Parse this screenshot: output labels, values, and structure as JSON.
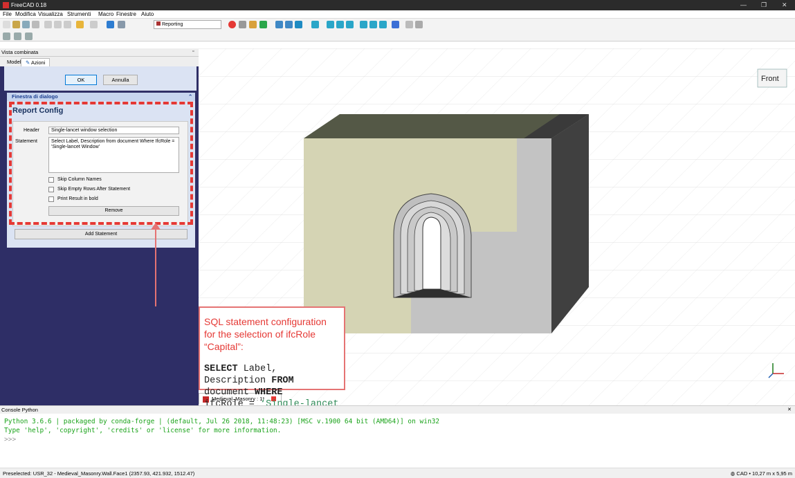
{
  "window": {
    "title": "FreeCAD 0.18"
  },
  "menu": [
    "File",
    "Modifica",
    "Visualizza",
    "Strumenti",
    "Macro",
    "Finestre",
    "Aiuto"
  ],
  "toolbar": {
    "workbench": "Reporting"
  },
  "panel": {
    "title": "Vista combinata",
    "tabs": [
      "Modello",
      "Azioni"
    ],
    "ok_label": "OK",
    "cancel_label": "Annulla",
    "dialog_title": "Finestra di dialogo",
    "config_title": "Report Config",
    "header_label": "Header",
    "header_value": "Single-lancet window selection",
    "statement_label": "Statement",
    "statement_value": "Select Label, Description from document Where IfcRole = 'Single-lancet Window'",
    "checkboxes": [
      "Skip Column Names",
      "Skip Empty Rows After Statement",
      "Print Result in bold"
    ],
    "remove_label": "Remove",
    "add_statement_label": "Add Statement"
  },
  "viewport": {
    "nav_cube": "Front",
    "doc_tab": "Medieval_Masonry : 1*"
  },
  "callout": {
    "line1": "SQL statement configuration for the selection  of ifcRole",
    "line2": "“Capital”:",
    "sql_kw1": "SELECT",
    "sql_t1": " Label, Description ",
    "sql_kw2": "FROM",
    "sql_t2": " document ",
    "sql_kw3": "WHERE",
    "sql_t3": "ifcRole = ",
    "sql_str": "‘Single-lancet Window’"
  },
  "console": {
    "title": "Console Python",
    "line1": "Python 3.6.6 | packaged by conda-forge | (default, Jul 26 2018, 11:48:23) [MSC v.1900 64 bit (AMD64)] on win32",
    "line2": "Type 'help', 'copyright', 'credits' or 'license' for more information.",
    "prompt": ">>>"
  },
  "status": {
    "preselected": "Preselected: USR_32 - Medieval_Masonry.Wall.Face1 (2357.93, 421.932, 1512.47)",
    "right": "CAD  •  10,27 m x 5,95 m"
  },
  "colors": {
    "accent": "#e53935",
    "panel_bg": "#2e2e66",
    "console_text": "#1aa31a"
  }
}
